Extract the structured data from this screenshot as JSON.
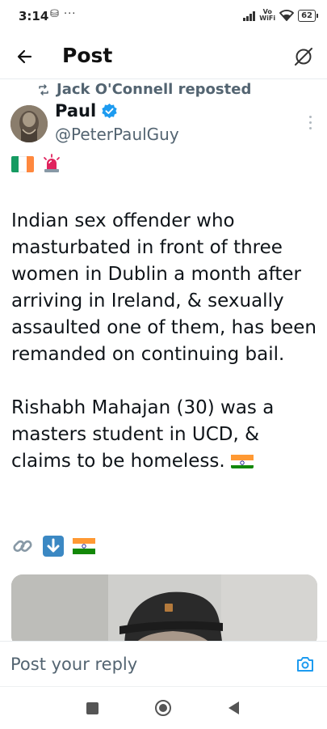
{
  "status_bar": {
    "time": "3:14",
    "icons": "⛁ ···",
    "vo": "Vo",
    "wifi": "WiFi",
    "battery": "62"
  },
  "header": {
    "title": "Post",
    "back_icon": "arrow-left-icon",
    "grok_icon": "grok-icon"
  },
  "post": {
    "repost_text": "Jack O'Connell reposted",
    "author_name": "Paul",
    "author_handle": "@PeterPaulGuy",
    "verified": true,
    "paragraph1": "Indian sex offender who masturbated in front of three women in Dublin a month after arriving in Ireland, & sexually assaulted one of them, has been remanded on continuing bail.",
    "paragraph2": "Rishabh Mahajan (30) was a masters student in UCD, & claims to be homeless.",
    "emoji_line_icons": [
      "link-icon",
      "down-arrow-icon",
      "india-flag-icon"
    ]
  },
  "reply": {
    "placeholder": "Post your reply"
  },
  "colors": {
    "text": "#0f1419",
    "secondary": "#536471",
    "accent": "#1d9bf0"
  }
}
